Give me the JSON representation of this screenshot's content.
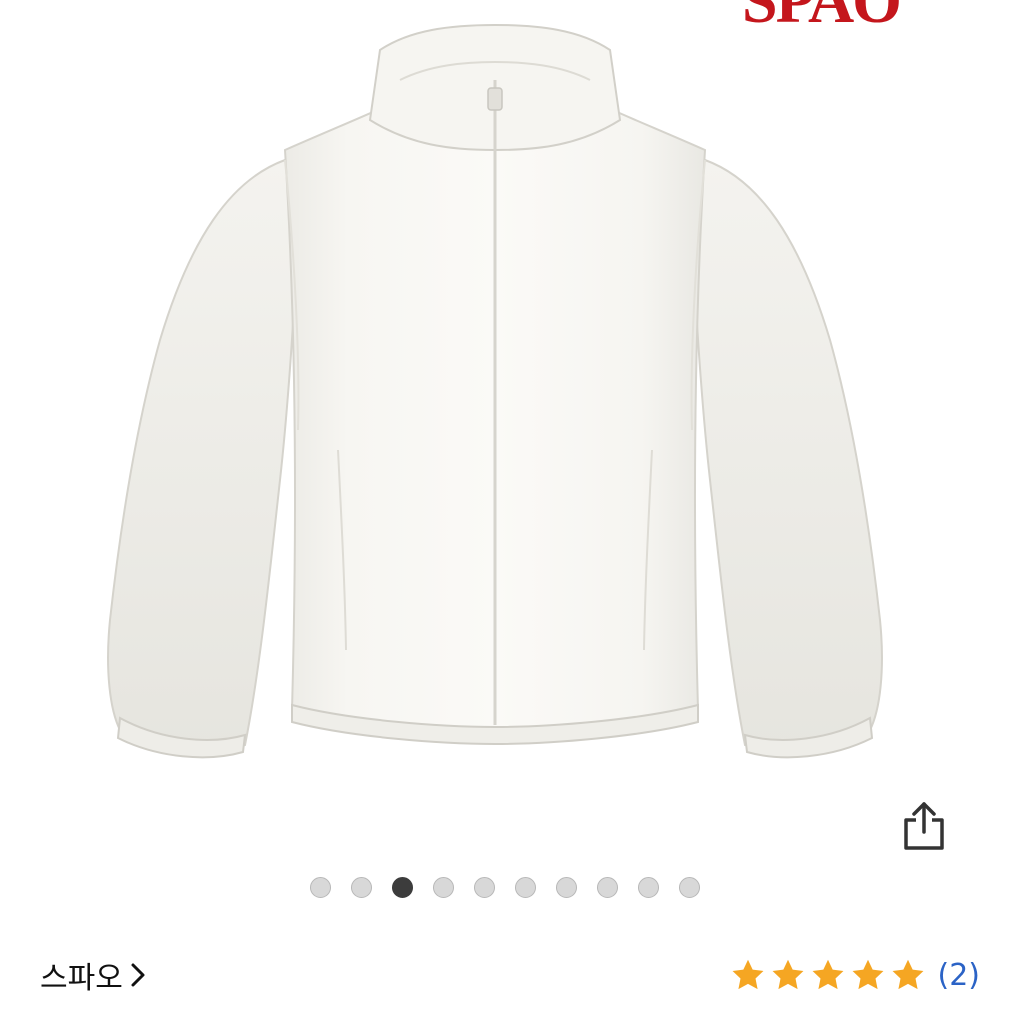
{
  "header": {
    "logo_text": "SPAO",
    "logo_color": "#c4161c"
  },
  "product": {
    "image_icon": "fleece-zip-jacket-image",
    "share_icon": "share-icon"
  },
  "carousel": {
    "total": 10,
    "active_index": 2,
    "active_color": "#3c3c3c",
    "inactive_color": "#d8d8d8"
  },
  "brand": {
    "name": "스파오",
    "chevron": "›"
  },
  "rating": {
    "stars": 5,
    "star_color": "#f5a623",
    "review_count_label": "(2)",
    "review_count_color": "#2b63c6"
  }
}
